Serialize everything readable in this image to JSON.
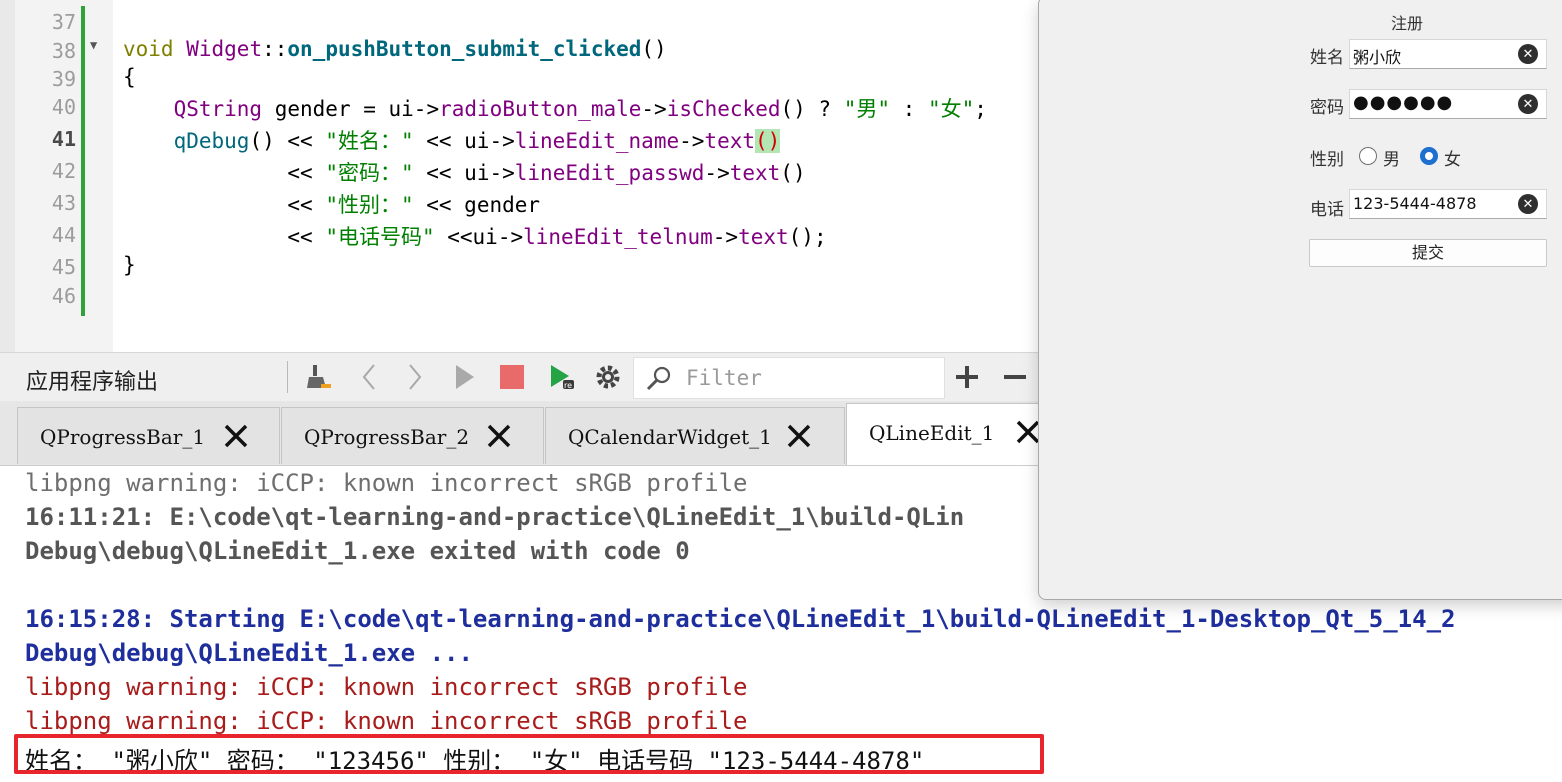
{
  "editor": {
    "line_numbers": [
      "37",
      "38",
      "39",
      "40",
      "41",
      "42",
      "43",
      "44",
      "45",
      "46"
    ],
    "current_line": "41",
    "code": {
      "l38_kw": "void",
      "l38_cls": "Widget",
      "l38_sep": "::",
      "l38_fn": "on_pushButton_submit_clicked",
      "l38_tail": "()",
      "l39": "{",
      "l40_cls": "QString",
      "l40_a": " gender = ui->",
      "l40_b": "radioButton_male",
      "l40_c": "->",
      "l40_d": "isChecked",
      "l40_e": "() ? ",
      "l40_s1": "\"男\"",
      "l40_f": " : ",
      "l40_s2": "\"女\"",
      "l40_g": ";",
      "l41_call": "qDebug",
      "l41_a": "() << ",
      "l41_s": "\"姓名：\"",
      "l41_b": " << ui->",
      "l41_c": "lineEdit_name",
      "l41_d": "->",
      "l41_e": "text",
      "l41_p": "()",
      "l42_a": "<< ",
      "l42_s": "\"密码：\"",
      "l42_b": " << ui->",
      "l42_c": "lineEdit_passwd",
      "l42_d": "->",
      "l42_e": "text",
      "l42_p": "()",
      "l43_a": "<< ",
      "l43_s": "\"性别：\"",
      "l43_b": " << gender",
      "l44_a": "<< ",
      "l44_s": "\"电话号码\"",
      "l44_b": " <<ui->",
      "l44_c": "lineEdit_telnum",
      "l44_d": "->",
      "l44_e": "text",
      "l44_f": "();",
      "l45": "}"
    }
  },
  "output_panel": {
    "title": "应用程序输出",
    "filter_placeholder": "Filter",
    "icons": [
      "broom-icon",
      "chevron-left-icon",
      "chevron-right-icon",
      "play-icon",
      "stop-icon",
      "run-debug-icon",
      "gear-icon",
      "search-icon",
      "plus-icon",
      "minus-icon"
    ],
    "colors": {
      "stop": "#e86a6a",
      "run": "#25a445"
    }
  },
  "tabs": [
    {
      "label": "QProgressBar_1",
      "active": false
    },
    {
      "label": "QProgressBar_2",
      "active": false
    },
    {
      "label": "QCalendarWidget_1",
      "active": false
    },
    {
      "label": "QLineEdit_1",
      "active": true
    }
  ],
  "output": {
    "lines": [
      "libpng warning: iCCP: known incorrect sRGB profile",
      "16:11:21: E:\\code\\qt-learning-and-practice\\QLineEdit_1\\build-QLin",
      "Debug\\debug\\QLineEdit_1.exe exited with code 0",
      "",
      "16:15:28: Starting E:\\code\\qt-learning-and-practice\\QLineEdit_1\\build-QLineEdit_1-Desktop_Qt_5_14_2",
      "Debug\\debug\\QLineEdit_1.exe ...",
      "libpng warning: iCCP: known incorrect sRGB profile",
      "libpng warning: iCCP: known incorrect sRGB profile",
      "姓名： \"粥小欣\" 密码： \"123456\" 性别： \"女\" 电话号码 \"123-5444-4878\""
    ],
    "highlight_color": "#e8242c"
  },
  "dialog": {
    "title": "注册",
    "name_label": "姓名",
    "name_value": "粥小欣",
    "password_label": "密码",
    "password_value": "●●●●●●",
    "gender_label": "性别",
    "gender_male": "男",
    "gender_female": "女",
    "gender_selected": "女",
    "phone_label": "电话",
    "phone_value": "123-5444-4878",
    "submit_label": "提交",
    "clear_glyph": "✕"
  }
}
